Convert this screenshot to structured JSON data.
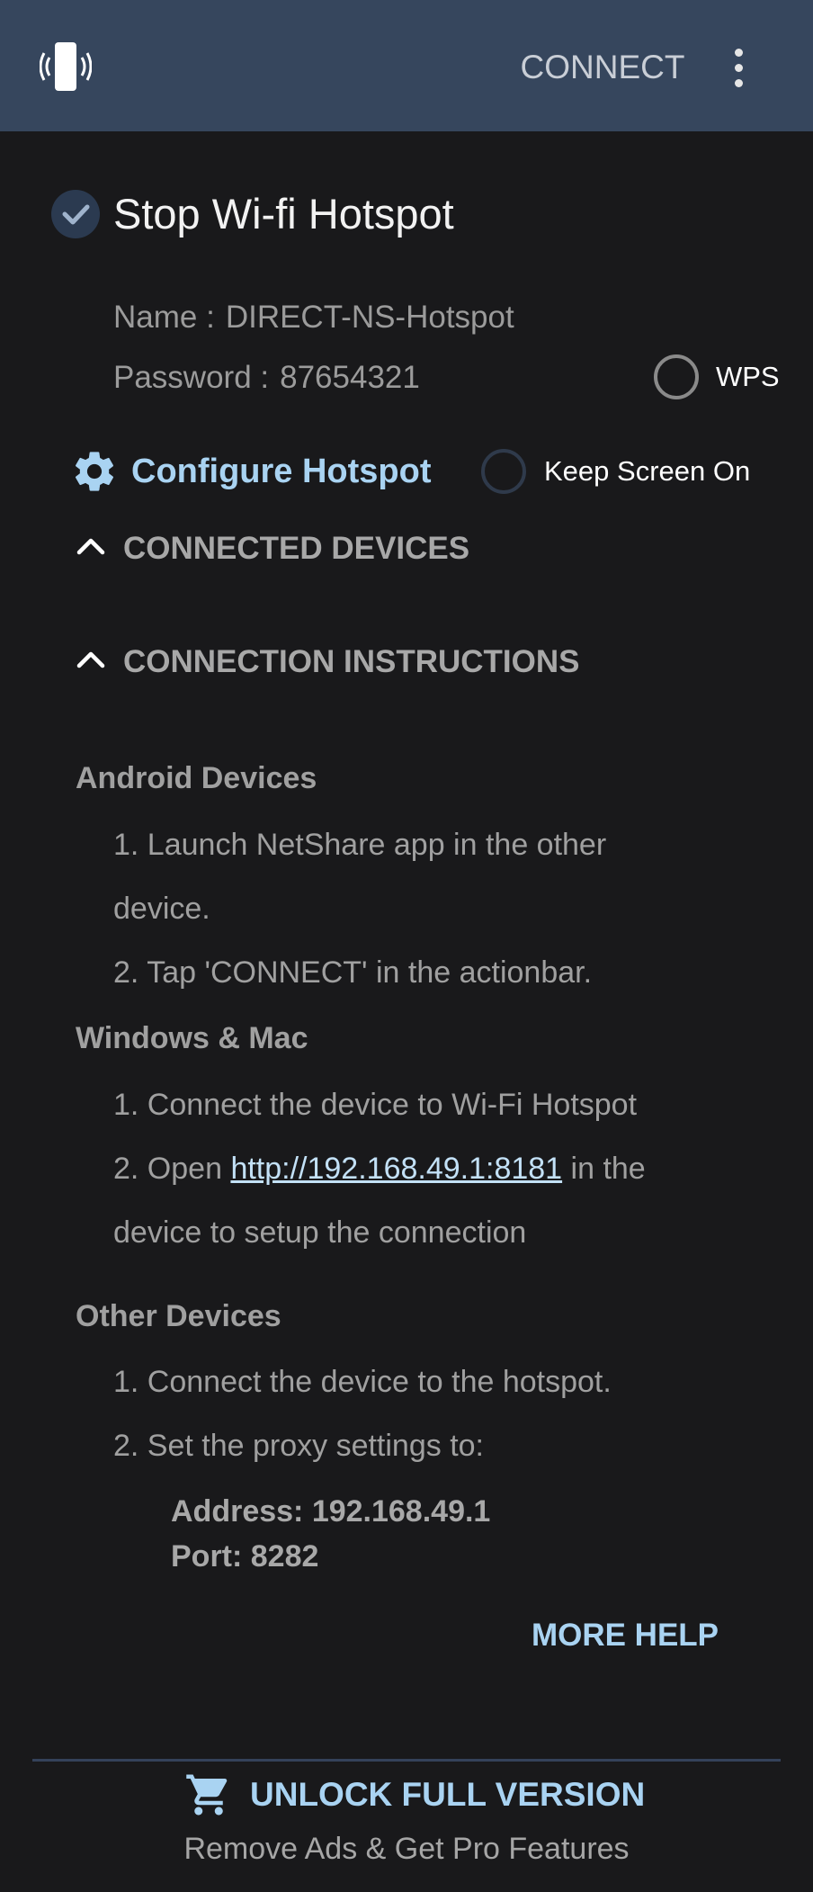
{
  "appbar": {
    "icon": "hotspot-signal-icon",
    "connect_label": "CONNECT",
    "menu_icon": "more-vert-icon",
    "color": "#36465d"
  },
  "hotspot": {
    "stop_label": "Stop Wi-fi Hotspot",
    "name_label": "Name :",
    "name_value": "DIRECT-NS-Hotspot",
    "password_label": "Password :",
    "password_value": "87654321",
    "wps_label": "WPS",
    "configure_label": "Configure Hotspot",
    "keep_screen_label": "Keep Screen On"
  },
  "sections": {
    "connected_devices": "CONNECTED DEVICES",
    "connection_instructions": "CONNECTION INSTRUCTIONS"
  },
  "instructions": {
    "android": {
      "title": "Android Devices",
      "step1_line1": "1. Launch NetShare app in the other",
      "step1_line2": "device.",
      "step2": "2. Tap 'CONNECT' in the actionbar."
    },
    "windows_mac": {
      "title": "Windows & Mac",
      "step1": "1. Connect the device to Wi-Fi Hotspot",
      "step2_prefix": "2. Open",
      "step2_link": "http://192.168.49.1:8181",
      "step2_suffix": "in the",
      "step2_line2": "device to setup the connection"
    },
    "other": {
      "title": "Other Devices",
      "step1": "1. Connect the device to the hotspot.",
      "step2": "2. Set the proxy settings to:",
      "address": "Address: 192.168.49.1",
      "port": "Port: 8282"
    }
  },
  "more_help": "MORE HELP",
  "unlock": {
    "title": "UNLOCK FULL VERSION",
    "subtitle": "Remove Ads & Get Pro Features",
    "icon": "shopping-cart-icon"
  },
  "colors": {
    "accent": "#a9d3f2",
    "background": "#19191b"
  }
}
